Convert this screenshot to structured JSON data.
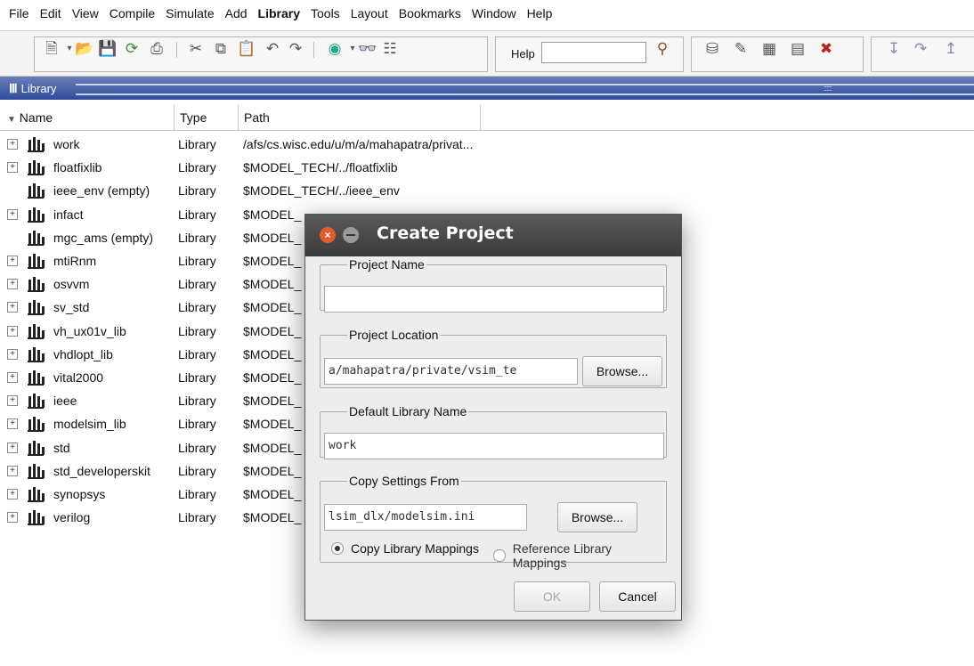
{
  "menu": [
    {
      "label": "File",
      "bold": false
    },
    {
      "label": "Edit",
      "bold": false
    },
    {
      "label": "View",
      "bold": false
    },
    {
      "label": "Compile",
      "bold": false
    },
    {
      "label": "Simulate",
      "bold": false
    },
    {
      "label": "Add",
      "bold": false
    },
    {
      "label": "Library",
      "bold": true
    },
    {
      "label": "Tools",
      "bold": false
    },
    {
      "label": "Layout",
      "bold": false
    },
    {
      "label": "Bookmarks",
      "bold": false
    },
    {
      "label": "Window",
      "bold": false
    },
    {
      "label": "Help",
      "bold": false
    }
  ],
  "toolbar": {
    "help_label": "Help",
    "help_value": ""
  },
  "library_panel": {
    "title": "Library"
  },
  "columns": [
    "Name",
    "Type",
    "Path"
  ],
  "rows": [
    {
      "name": "work",
      "type": "Library",
      "path": "/afs/cs.wisc.edu/u/m/a/mahapatra/privat...",
      "expandable": true
    },
    {
      "name": "floatfixlib",
      "type": "Library",
      "path": "$MODEL_TECH/../floatfixlib",
      "expandable": true
    },
    {
      "name": "ieee_env  (empty)",
      "type": "Library",
      "path": "$MODEL_TECH/../ieee_env",
      "expandable": false
    },
    {
      "name": "infact",
      "type": "Library",
      "path": "$MODEL_",
      "expandable": true
    },
    {
      "name": "mgc_ams  (empty)",
      "type": "Library",
      "path": "$MODEL_",
      "expandable": false
    },
    {
      "name": "mtiRnm",
      "type": "Library",
      "path": "$MODEL_",
      "expandable": true
    },
    {
      "name": "osvvm",
      "type": "Library",
      "path": "$MODEL_",
      "expandable": true
    },
    {
      "name": "sv_std",
      "type": "Library",
      "path": "$MODEL_",
      "expandable": true
    },
    {
      "name": "vh_ux01v_lib",
      "type": "Library",
      "path": "$MODEL_",
      "expandable": true
    },
    {
      "name": "vhdlopt_lib",
      "type": "Library",
      "path": "$MODEL_",
      "expandable": true
    },
    {
      "name": "vital2000",
      "type": "Library",
      "path": "$MODEL_",
      "expandable": true
    },
    {
      "name": "ieee",
      "type": "Library",
      "path": "$MODEL_",
      "expandable": true
    },
    {
      "name": "modelsim_lib",
      "type": "Library",
      "path": "$MODEL_",
      "expandable": true
    },
    {
      "name": "std",
      "type": "Library",
      "path": "$MODEL_",
      "expandable": true
    },
    {
      "name": "std_developerskit",
      "type": "Library",
      "path": "$MODEL_",
      "expandable": true
    },
    {
      "name": "synopsys",
      "type": "Library",
      "path": "$MODEL_",
      "expandable": true
    },
    {
      "name": "verilog",
      "type": "Library",
      "path": "$MODEL_",
      "expandable": true
    }
  ],
  "dialog": {
    "title": "Create Project",
    "project_name": {
      "legend": "Project Name",
      "value": ""
    },
    "project_location": {
      "legend": "Project Location",
      "value": "a/mahapatra/private/vsim_te",
      "browse": "Browse..."
    },
    "default_library": {
      "legend": "Default Library Name",
      "value": "work"
    },
    "copy_settings": {
      "legend": "Copy Settings From",
      "value": "lsim_dlx/modelsim.ini",
      "browse": "Browse...",
      "radio_copy": "Copy Library Mappings",
      "radio_reference": "Reference Library Mappings",
      "selected": "copy"
    },
    "ok": "OK",
    "cancel": "Cancel"
  }
}
